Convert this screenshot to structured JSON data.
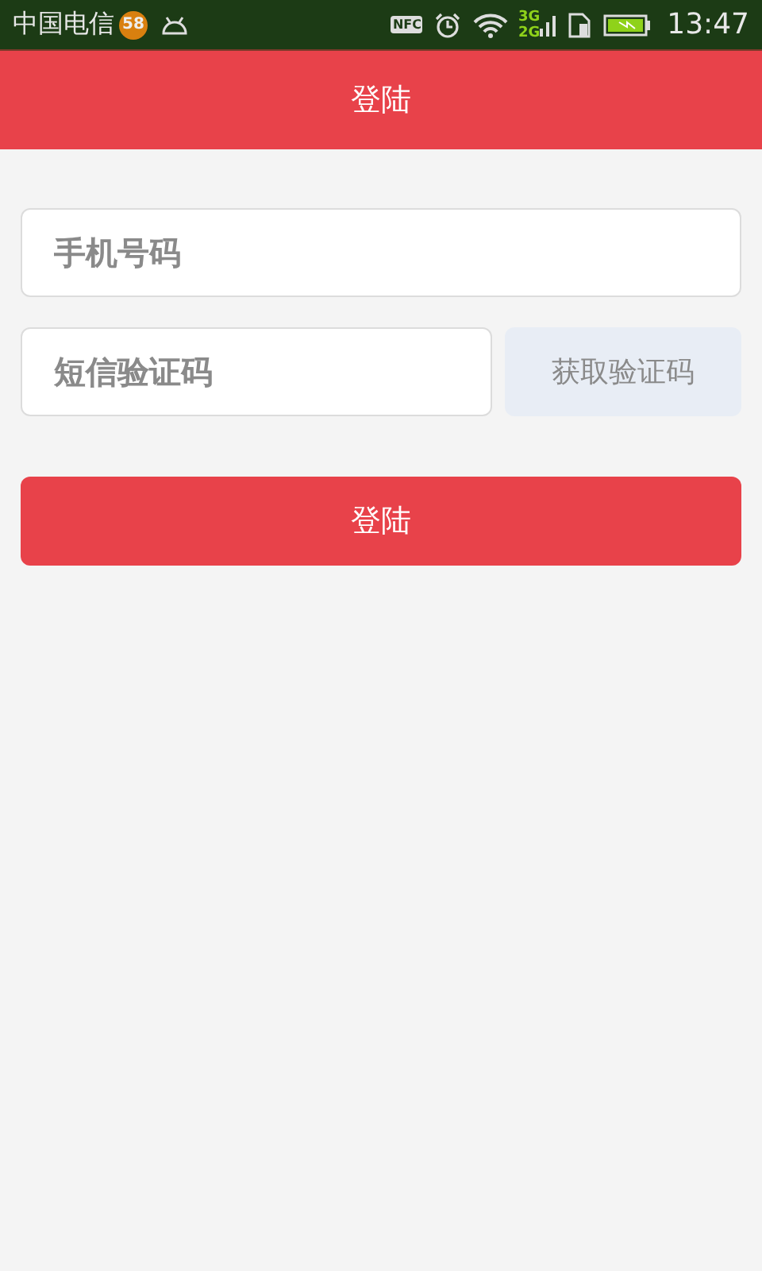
{
  "status_bar": {
    "carrier": "中国电信",
    "badge": "58",
    "nfc": "NFC",
    "network_top": "3G",
    "network_bottom": "2G",
    "time": "13:47"
  },
  "app_bar": {
    "title": "登陆"
  },
  "form": {
    "phone": {
      "placeholder": "手机号码"
    },
    "code": {
      "placeholder": "短信验证码"
    },
    "get_code_button": "获取验证码",
    "submit_button": "登陆"
  }
}
